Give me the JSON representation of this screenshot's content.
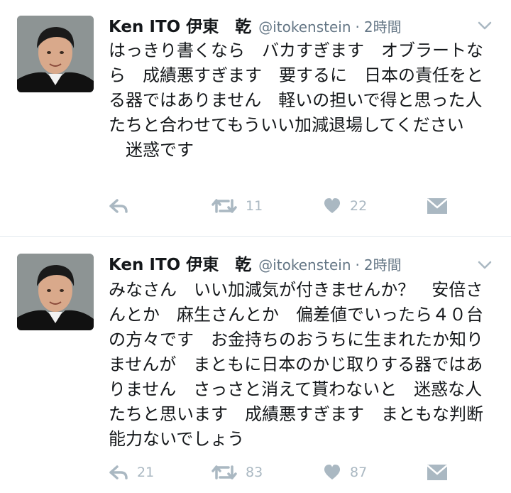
{
  "tweets": [
    {
      "name": "Ken ITO 伊東　乾",
      "handle": "@itokenstein",
      "separator": "·",
      "time": "2時間",
      "text": "はっきり書くなら　バカすぎます　オブラートなら　成績悪すぎます　要するに　日本の責任をとる器ではありません　軽いの担いで得と思った人たちと合わせてもういい加減退場してください\n　迷惑です",
      "reply_count": "",
      "retweet_count": "11",
      "like_count": "22"
    },
    {
      "name": "Ken ITO 伊東　乾",
      "handle": "@itokenstein",
      "separator": "·",
      "time": "2時間",
      "text": "みなさん　いい加減気が付きませんか？　安倍さんとか　麻生さんとか　偏差値でいったら４０台の方々です　お金持ちのおうちに生まれたか知りませんが　まともに日本のかじ取りする器ではありません　さっさと消えて貰わないと　迷惑な人たちと思います　成績悪すぎます　まともな判断能力ないでしょう",
      "reply_count": "21",
      "retweet_count": "83",
      "like_count": "87"
    }
  ],
  "icons": {
    "avatar": "avatar",
    "menu": "chevron-down-icon",
    "reply": "reply-icon",
    "retweet": "retweet-icon",
    "like": "heart-icon",
    "dm": "envelope-icon"
  },
  "colors": {
    "text": "#14171a",
    "secondary": "#657786",
    "icon": "#aab8c2",
    "divider": "#e1e8ed"
  }
}
